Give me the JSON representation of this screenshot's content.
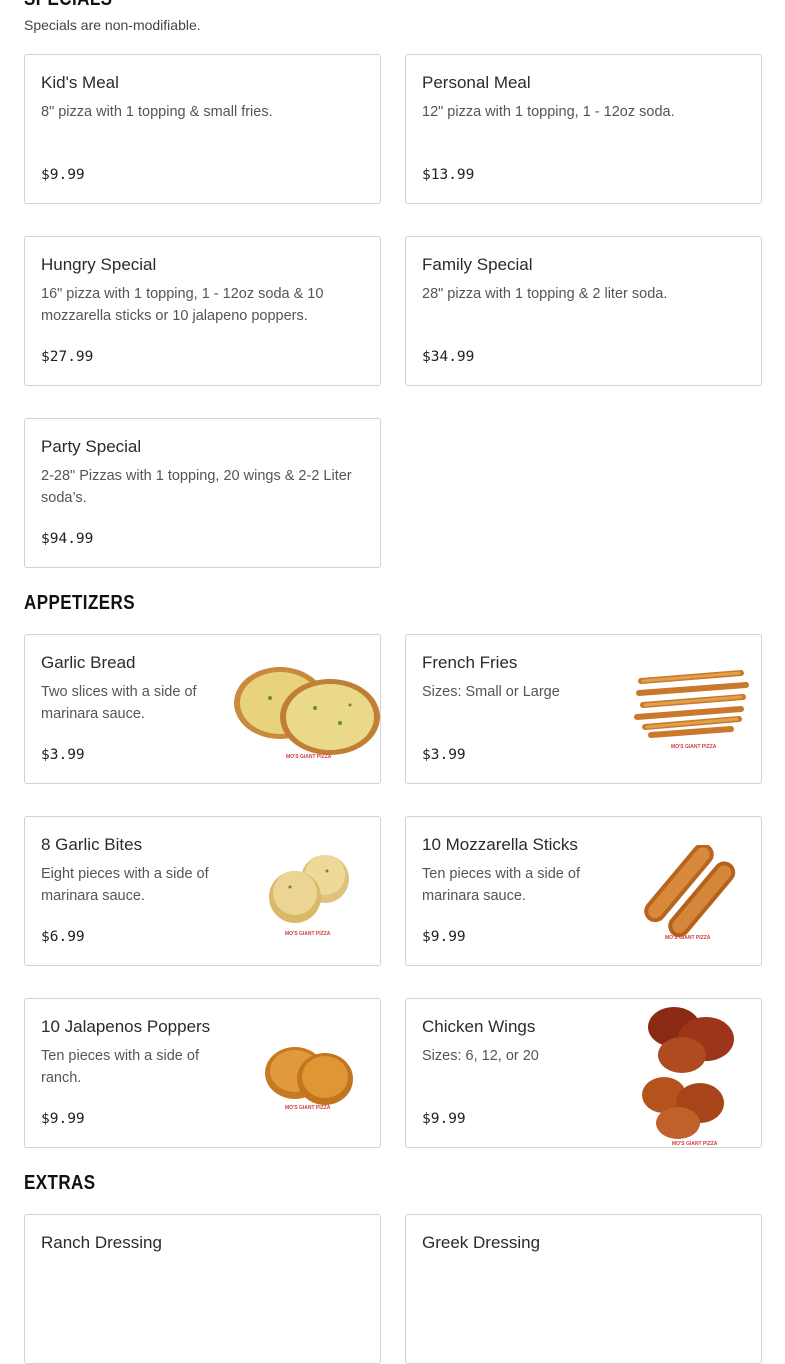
{
  "specials": {
    "heading": "SPECIALS",
    "note": "Specials are non-modifiable.",
    "items": [
      {
        "name": "Kid's Meal",
        "description": "8\" pizza with 1 topping & small fries.",
        "price": "$9.99"
      },
      {
        "name": "Personal Meal",
        "description": "12\" pizza with 1 topping, 1 - 12oz soda.",
        "price": "$13.99"
      },
      {
        "name": "Hungry Special",
        "description": "16\" pizza with 1 topping, 1 - 12oz soda & 10 mozzarella sticks or 10 jalapeno poppers.",
        "price": "$27.99"
      },
      {
        "name": "Family Special",
        "description": "28\" pizza with 1 topping & 2 liter soda.",
        "price": "$34.99"
      },
      {
        "name": "Party Special",
        "description": "2-28\" Pizzas with 1 topping, 20 wings & 2-2 Liter soda’s.",
        "price": "$94.99"
      }
    ]
  },
  "appetizers": {
    "heading": "APPETIZERS",
    "items": [
      {
        "name": "Garlic Bread",
        "description": "Two slices with a side of marinara sauce.",
        "price": "$3.99",
        "image": "garlic-bread-image"
      },
      {
        "name": "French Fries",
        "description": "Sizes: Small or Large",
        "price": "$3.99",
        "image": "french-fries-image"
      },
      {
        "name": "8 Garlic Bites",
        "description": "Eight pieces with a side of marinara sauce.",
        "price": "$6.99",
        "image": "garlic-bites-image"
      },
      {
        "name": "10 Mozzarella Sticks",
        "description": "Ten pieces with a side of marinara sauce.",
        "price": "$9.99",
        "image": "mozzarella-sticks-image"
      },
      {
        "name": "10 Jalapenos Poppers",
        "description": "Ten pieces with a side of ranch.",
        "price": "$9.99",
        "image": "jalapeno-poppers-image"
      },
      {
        "name": "Chicken Wings",
        "description": "Sizes: 6, 12, or 20",
        "price": "$9.99",
        "image": "chicken-wings-image"
      }
    ]
  },
  "extras": {
    "heading": "EXTRAS",
    "items": [
      {
        "name": "Ranch Dressing"
      },
      {
        "name": "Greek Dressing"
      }
    ]
  },
  "watermark": "MO'S GIANT PIZZA",
  "colors": {
    "border": "#d3d3d3",
    "text": "#222222",
    "muted": "#555555",
    "watermark": "#d23c3c"
  }
}
